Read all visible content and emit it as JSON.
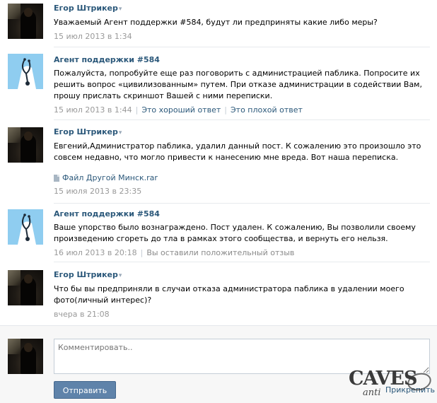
{
  "messages": [
    {
      "author": "Егор Штрикер",
      "caret": "▾",
      "text": "Уважаемый Агент поддержки #584, будут ли предприняты какие либо меры?",
      "date": "15 июл 2013 в 1:34"
    },
    {
      "author": "Агент поддержки #584",
      "text": "Пожалуйста, попробуйте еще раз поговорить с администрацией паблика. Попросите их решить вопрос «цивилизованным» путем. При отказе администрации в содействии Вам, прошу прислать скриншот Вашей с ними переписки.",
      "date": "15 июл 2013 в 1:44",
      "good_answer": "Это хороший ответ",
      "bad_answer": "Это плохой ответ"
    },
    {
      "author": "Егор Штрикер",
      "caret": "▾",
      "text": "Евгений,Администратор паблика, удалил данный пост. К сожалению это произошло это совсем недавно, что могло привести к нанесению мне вреда. Вот наша переписка.",
      "attachment": "Файл Другой Минск.rar",
      "date": "15 июля 2013 в 23:35"
    },
    {
      "author": "Агент поддержки #584",
      "text": "Ваше упорство было вознаграждено. Пост удален. К сожалению, Вы позволили своему произведению сгореть до тла в рамках этого сообщества, и вернуть его нельзя.",
      "date": "16 июл 2013 в 20:18",
      "feedback": "Вы оставили положительный отзыв"
    },
    {
      "author": "Егор Штрикер",
      "caret": "▾",
      "text": "Что бы вы предприняли в случаи отказа администратора паблика в удалении моего фото(личный интерес)?",
      "date": "вчера в 21:08"
    }
  ],
  "reply": {
    "placeholder": "Комментировать..",
    "send_label": "Отправить",
    "attach_label": "Прикрепить"
  },
  "watermark": {
    "main": "CAVES",
    "sub": "anti"
  },
  "colors": {
    "link": "#2b587a",
    "meta": "#999999",
    "button": "#5f83aa",
    "agent_avatar_bg": "#8fcdf0"
  }
}
